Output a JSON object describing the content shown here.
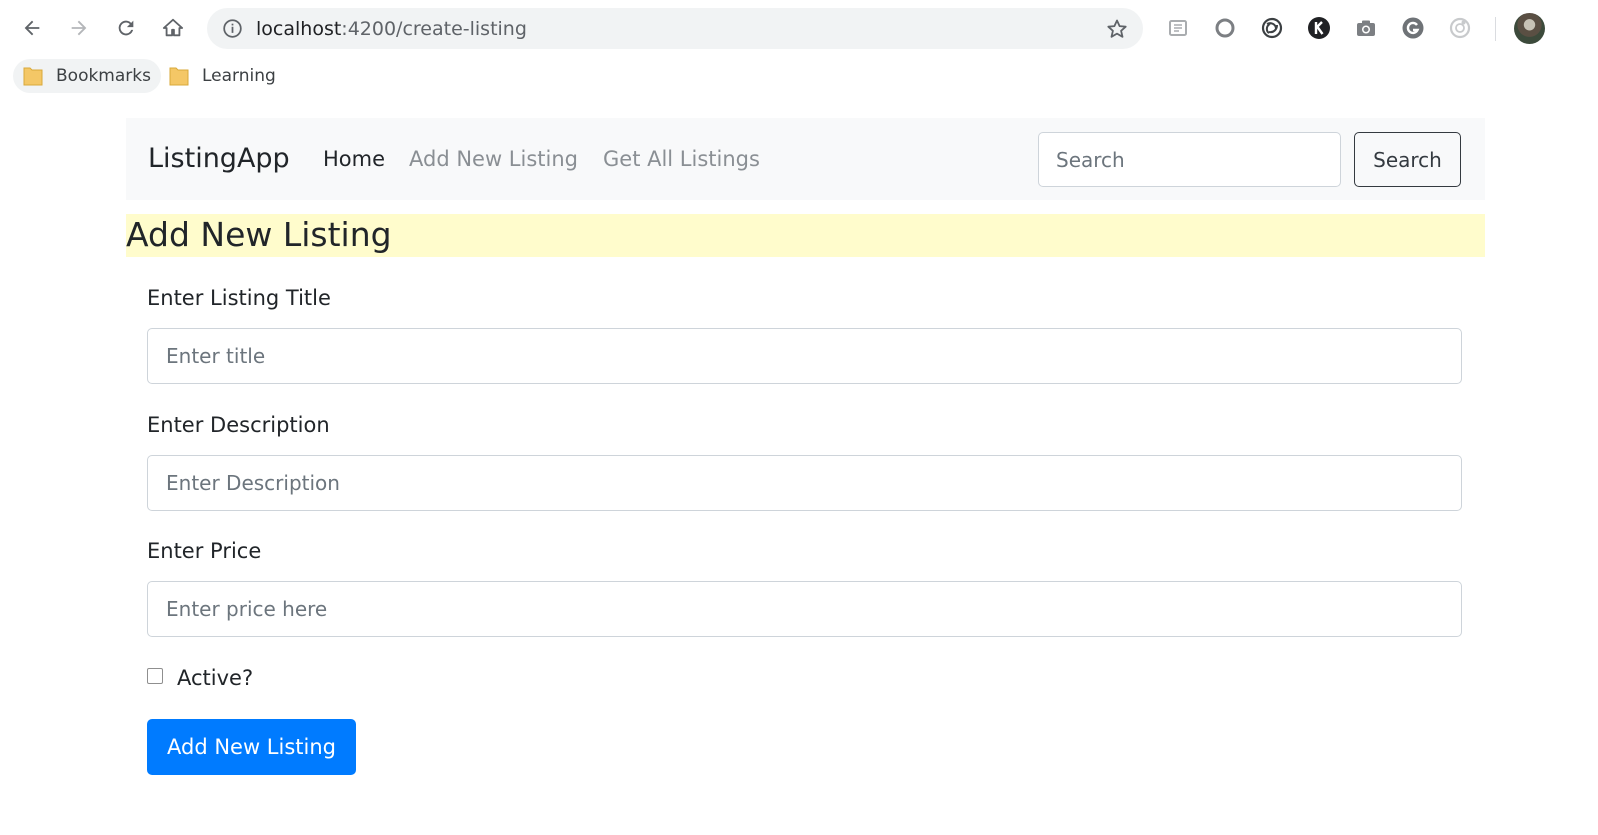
{
  "browser": {
    "url_host": "localhost",
    "url_path": ":4200/create-listing",
    "bookmarks": [
      {
        "label": "Bookmarks"
      },
      {
        "label": "Learning"
      }
    ],
    "extensions": [
      "reader-mode-icon",
      "circle-extension-icon",
      "spiral-extension-icon",
      "k-extension-icon",
      "camera-icon",
      "grammarly-icon",
      "ring-extension-icon"
    ]
  },
  "navbar": {
    "brand": "ListingApp",
    "links": [
      {
        "label": "Home",
        "active": true
      },
      {
        "label": "Add New Listing",
        "active": false
      },
      {
        "label": "Get All Listings",
        "active": false
      }
    ],
    "search": {
      "placeholder": "Search",
      "button_label": "Search"
    }
  },
  "page": {
    "heading": "Add New Listing",
    "heading_bg": "#fffccc"
  },
  "form": {
    "title": {
      "label": "Enter Listing Title",
      "placeholder": "Enter title",
      "value": ""
    },
    "description": {
      "label": "Enter Description",
      "placeholder": "Enter Description",
      "value": ""
    },
    "price": {
      "label": "Enter Price",
      "placeholder": "Enter price here",
      "value": ""
    },
    "active": {
      "label": "Active?",
      "checked": false
    },
    "submit_label": "Add New Listing"
  },
  "colors": {
    "primary": "#007bff",
    "navbar_bg": "#f8f9fa",
    "muted_link": "#8a8f94"
  }
}
